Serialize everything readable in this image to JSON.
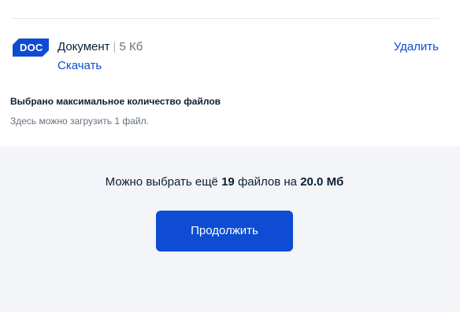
{
  "file": {
    "badge": "DOC",
    "name": "Документ",
    "separator": "|",
    "size": "5 Кб",
    "download_label": "Скачать",
    "delete_label": "Удалить"
  },
  "limit_message": {
    "title": "Выбрано максимальное количество файлов",
    "subtitle": "Здесь можно загрузить 1 файл."
  },
  "remaining": {
    "prefix": "Можно выбрать ещё",
    "count": "19",
    "middle": "файлов на",
    "size": "20.0 Мб"
  },
  "continue_button": {
    "label": "Продолжить"
  },
  "colors": {
    "accent": "#0d4cd3",
    "background": "#f3f5f9",
    "card": "#ffffff",
    "text": "#0b1f33",
    "secondary_text": "#66727f"
  },
  "icons": {
    "file_type": "doc-file-icon"
  }
}
